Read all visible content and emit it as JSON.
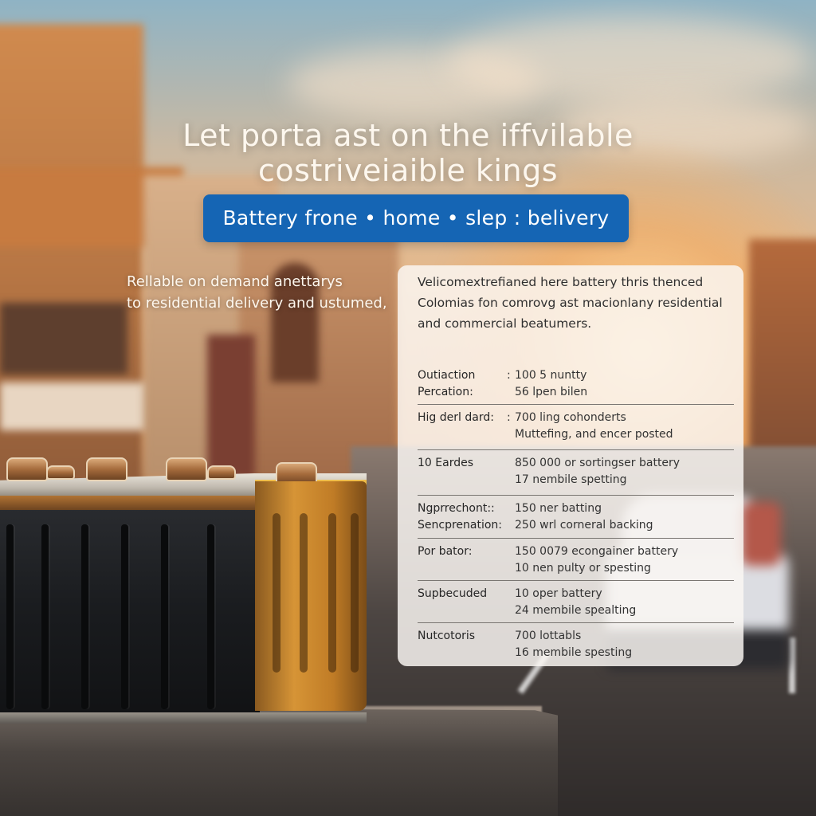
{
  "headline": {
    "line1": "Let porta ast on the iffvilable",
    "line2": "costriveiaible kings"
  },
  "tagline": "Battery frone • home • slep : belivery",
  "lead": {
    "line1": "Rellable on demand anettarys",
    "line2": "to residential delivery and ustumed,"
  },
  "panel": {
    "intro": [
      "Velicomextrefianed here battery thris thenced",
      "Colomias fon comrovg ast macionlany residential",
      "and commercial beatumers."
    ],
    "rows": [
      {
        "label": [
          "Outiaction",
          "Percation:"
        ],
        "sep": ":",
        "value": [
          "100 5 nuntty",
          "56 lpen bilen"
        ]
      },
      {
        "label": [
          "Hig derl dard:"
        ],
        "sep": ":",
        "value": [
          "700 ling cohonderts",
          "Muttefing, and encer posted"
        ]
      },
      {
        "label": [
          "10 Eardes"
        ],
        "sep": "",
        "value": [
          "850 000 or sortingser battery",
          "17 nembile spetting"
        ]
      },
      {
        "label": [
          "Ngprrechont::",
          "Sencprenation:"
        ],
        "sep": "",
        "value": [
          "150 ner batting",
          "250 wrl corneral backing"
        ]
      },
      {
        "label": [
          "Por bator:"
        ],
        "sep": "",
        "value": [
          "150 0079 econgainer battery",
          "10 nen pulty or spesting"
        ]
      },
      {
        "label": [
          "Supbecuded"
        ],
        "sep": "",
        "value": [
          "10 oper battery",
          "24 membile spealting"
        ]
      },
      {
        "label": [
          "Nutcotoris"
        ],
        "sep": "",
        "value": [
          "700 lottabls",
          "16 membile spesting"
        ]
      }
    ]
  },
  "colors": {
    "pill": "#1565b4",
    "headline_text": "#fdf7ee",
    "panel_bg": "rgba(250,247,243,0.84)"
  }
}
